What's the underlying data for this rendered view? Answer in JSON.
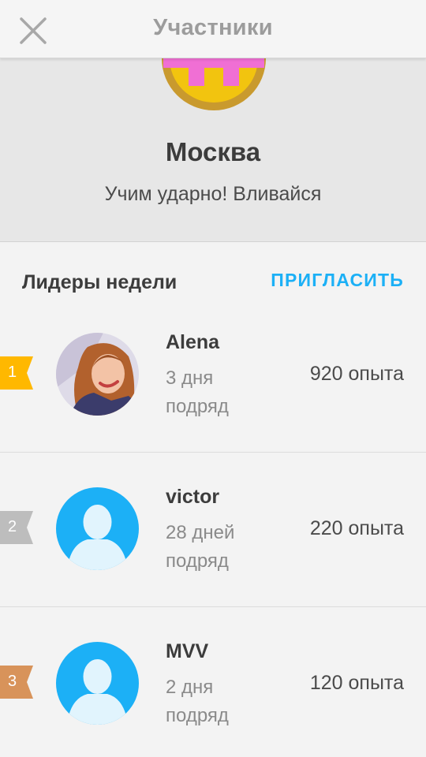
{
  "header": {
    "title": "Участники",
    "close_icon": "close-icon"
  },
  "club": {
    "name": "Москва",
    "description": "Учим ударно! Вливайся",
    "badge_icon": "club-badge-icon",
    "badge_colors": {
      "face": "#f2c40f",
      "ring": "#c99a2e",
      "crown": "#f06fd4"
    }
  },
  "leaderboard": {
    "title": "Лидеры недели",
    "invite_label": "ПРИГЛАСИТЬ",
    "accent_color": "#1cb0f6",
    "entries": [
      {
        "rank": "1",
        "name": "Alena",
        "streak": "3 дня подряд",
        "xp": "920 опыта",
        "avatar": "photo-avatar",
        "ribbon_color": "#ffb800"
      },
      {
        "rank": "2",
        "name": "victor",
        "streak": "28 дней подряд",
        "xp": "220 опыта",
        "avatar": "default-avatar-icon",
        "ribbon_color": "#bdbdbd"
      },
      {
        "rank": "3",
        "name": "MVV",
        "streak": "2 дня подряд",
        "xp": "120 опыта",
        "avatar": "default-avatar-icon",
        "ribbon_color": "#d8935a"
      }
    ]
  }
}
